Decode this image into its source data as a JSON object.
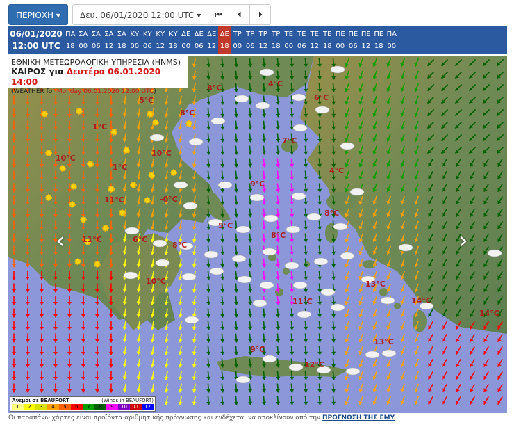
{
  "toolbar": {
    "region_label": "ΠΕΡΙΟΧΗ",
    "date_label": "Δευ. 06/01/2020 12:00 UTC",
    "first_icon": "skip-first-icon",
    "prev_icon": "step-back-icon",
    "next_icon": "step-forward-icon"
  },
  "timeline": {
    "current_date": "06/01/2020",
    "current_time": "12:00 UTC",
    "active_index": 12,
    "slots": [
      {
        "day": "ΠΑ",
        "hour": "18"
      },
      {
        "day": "ΣΑ",
        "hour": "00"
      },
      {
        "day": "ΣΑ",
        "hour": "06"
      },
      {
        "day": "ΣΑ",
        "hour": "12"
      },
      {
        "day": "ΣΑ",
        "hour": "18"
      },
      {
        "day": "ΚΥ",
        "hour": "00"
      },
      {
        "day": "ΚΥ",
        "hour": "06"
      },
      {
        "day": "ΚΥ",
        "hour": "12"
      },
      {
        "day": "ΚΥ",
        "hour": "18"
      },
      {
        "day": "ΔΕ",
        "hour": "00"
      },
      {
        "day": "ΔΕ",
        "hour": "06"
      },
      {
        "day": "ΔΕ",
        "hour": "12"
      },
      {
        "day": "ΔΕ",
        "hour": "18"
      },
      {
        "day": "ΤΡ",
        "hour": "00"
      },
      {
        "day": "ΤΡ",
        "hour": "06"
      },
      {
        "day": "ΤΡ",
        "hour": "12"
      },
      {
        "day": "ΤΡ",
        "hour": "18"
      },
      {
        "day": "ΤΕ",
        "hour": "00"
      },
      {
        "day": "ΤΕ",
        "hour": "06"
      },
      {
        "day": "ΤΕ",
        "hour": "12"
      },
      {
        "day": "ΤΕ",
        "hour": "18"
      },
      {
        "day": "ΠΕ",
        "hour": "00"
      },
      {
        "day": "ΠΕ",
        "hour": "06"
      },
      {
        "day": "ΠΕ",
        "hour": "12"
      },
      {
        "day": "ΠΕ",
        "hour": "18"
      },
      {
        "day": "ΠΑ",
        "hour": "00"
      }
    ]
  },
  "map": {
    "title_line1": "ΕΘΝΙΚΗ ΜΕΤΕΩΡΟΛΟΓΙΚΗ ΥΠΗΡΕΣΙΑ (HNMS)",
    "title_line2_prefix": "ΚΑΙΡΟΣ για ",
    "title_line2_date": "Δευτέρα 06.01.2020 14:00",
    "title_line3_prefix": "(WEATHER for ",
    "title_line3_date": "Monday 06.01.2020 12:00 UTC",
    "title_line3_suffix": ")",
    "temperatures": [
      "8°C",
      "4°C",
      "6°C",
      "5°C",
      "8°C",
      "1°C",
      "7°C",
      "10°C",
      "10°C",
      "1°C",
      "4°C",
      "9°C",
      "-0°C",
      "11°C",
      "8°C",
      "5°C",
      "8°C",
      "11°C",
      "6°C",
      "8°C",
      "10°C",
      "13°C",
      "14°C",
      "11°C",
      "14°C",
      "13°C",
      "9°C",
      "12°C"
    ],
    "colors": {
      "sea": "#8b97d8",
      "land_low": "#6f8a55",
      "land_high": "#9a8f4a",
      "temp_text": "#b01c1c"
    }
  },
  "legend": {
    "title_gr": "Άνεμοι σε BEAUFORT",
    "title_en": "(Winds in BEAUFORT)",
    "levels": [
      "1",
      "2",
      "3",
      "4",
      "5",
      "6",
      "7",
      "8",
      "9",
      "10",
      "11",
      "12"
    ],
    "level_colors": [
      "#ffff80",
      "#ffff00",
      "#d8e000",
      "#ffa000",
      "#ff6000",
      "#ff0000",
      "#00a000",
      "#006000",
      "#ff00ff",
      "#8000c0",
      "#d00000",
      "#0000ff"
    ]
  },
  "footer": {
    "text": "Οι παραπάνω χάρτες είναι προϊόντα αριθμητικής πρόγνωσης και ενδέχεται να αποκλίνουν από την ",
    "link": "ΠΡΟΓΝΩΣΗ ΤΗΣ ΕΜΥ",
    "end": "."
  }
}
